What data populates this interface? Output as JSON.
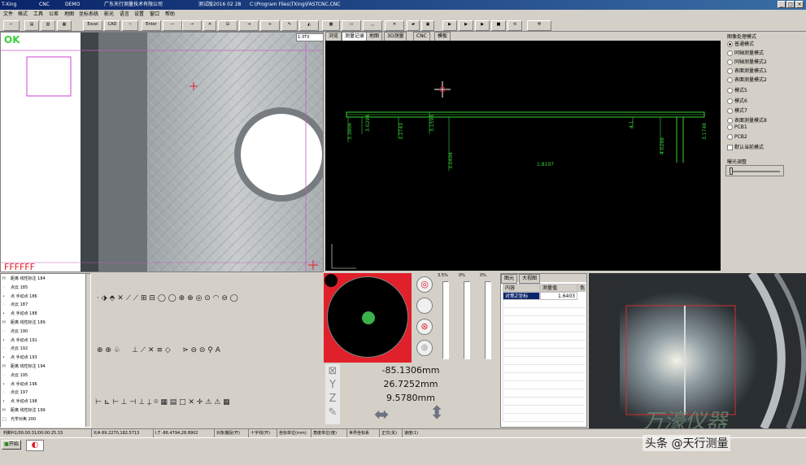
{
  "title": {
    "app": "T-Xing",
    "mode": "CNC",
    "demo": "DEMO",
    "company": "广东天行测量技术有限公司",
    "version": "测试版2016 02 28",
    "path": "C:\\Program Files\\TXing\\FASTCNC.CNC"
  },
  "menu": [
    "文件",
    "格式",
    "工具",
    "公差",
    "地图",
    "坐标系统",
    "影光",
    "语言",
    "设置",
    "窗口",
    "帮助"
  ],
  "toolbar": {
    "excel": "Excel",
    "cad": "CAD",
    "enter": "Enter"
  },
  "camera": {
    "ok": "OK",
    "color_code": "FFFFFF",
    "zoom_select": "1-3TX"
  },
  "graphic_tabs": [
    "浏览",
    "测量记录",
    "地图",
    "3D测量",
    "CNC",
    "模板"
  ],
  "graphic_labels": [
    "3.3806",
    "3.0294",
    "3.2743",
    "3.1598",
    "3.0494",
    "1.8197",
    "4.1",
    "4.0288",
    "3.1748"
  ],
  "mode_panel": {
    "title": "图像处理模式",
    "options": [
      "普通模式",
      "同轴测量模式",
      "同轴测量模式2",
      "表面测量模式1",
      "表面测量模式2",
      "模式5",
      "模式6",
      "模式7",
      "表面测量模式8",
      "PCB1",
      "PCB2"
    ],
    "checkbox": "默认当前模式",
    "slider_label": "曝光调整"
  },
  "tree": [
    {
      "icon": "H",
      "text": "距离  线性标注  184"
    },
    {
      "icon": "◦",
      "text": "点云  185"
    },
    {
      "icon": "•",
      "text": "点    手动点  186"
    },
    {
      "icon": "◦",
      "text": "点云  187"
    },
    {
      "icon": "•",
      "text": "点    手动点  188"
    },
    {
      "icon": "H",
      "text": "距离  线性标注  189"
    },
    {
      "icon": "◦",
      "text": "点云  190"
    },
    {
      "icon": "•",
      "text": "点    手动点  191"
    },
    {
      "icon": "◦",
      "text": "点云  192"
    },
    {
      "icon": "•",
      "text": "点    手动点  193"
    },
    {
      "icon": "H",
      "text": "距离  线性标注  194"
    },
    {
      "icon": "◦",
      "text": "点云  195"
    },
    {
      "icon": "•",
      "text": "点    手动点  196"
    },
    {
      "icon": "◦",
      "text": "点云  197"
    },
    {
      "icon": "•",
      "text": "点    手动点  198"
    },
    {
      "icon": "H",
      "text": "距离  线性标注  199"
    },
    {
      "icon": "□",
      "text": "光学对焦  200"
    }
  ],
  "coords": {
    "x": "-85.1306mm",
    "y": "26.7252mm",
    "z": "9.5780mm"
  },
  "light_bars": [
    "3.5%",
    "0%",
    "0%"
  ],
  "results": {
    "tabs": [
      "图元",
      "大视图"
    ],
    "headers": [
      "内容",
      "测量值",
      "色"
    ],
    "rows": [
      {
        "name": "对焦Z坐标",
        "value": "1.6403"
      }
    ]
  },
  "status": [
    "判断H1/00:00:31/00:00:25.33",
    "X/A 69.2270,182.5713",
    "I,T -86.4794,28.8902",
    "对象捕捉(开)",
    "十字线(开)",
    "坐标单位(mm)",
    "角度单位(度)",
    "世界坐标系",
    "正交(关)",
    "速度(1)"
  ],
  "taskbar": {
    "start": "开始"
  },
  "watermark": {
    "brand": "万濠仪器",
    "author": "头条 @天行测量"
  },
  "colors": {
    "green": "#3bd13b",
    "red": "#e0202a",
    "magenta": "#d040d0"
  }
}
